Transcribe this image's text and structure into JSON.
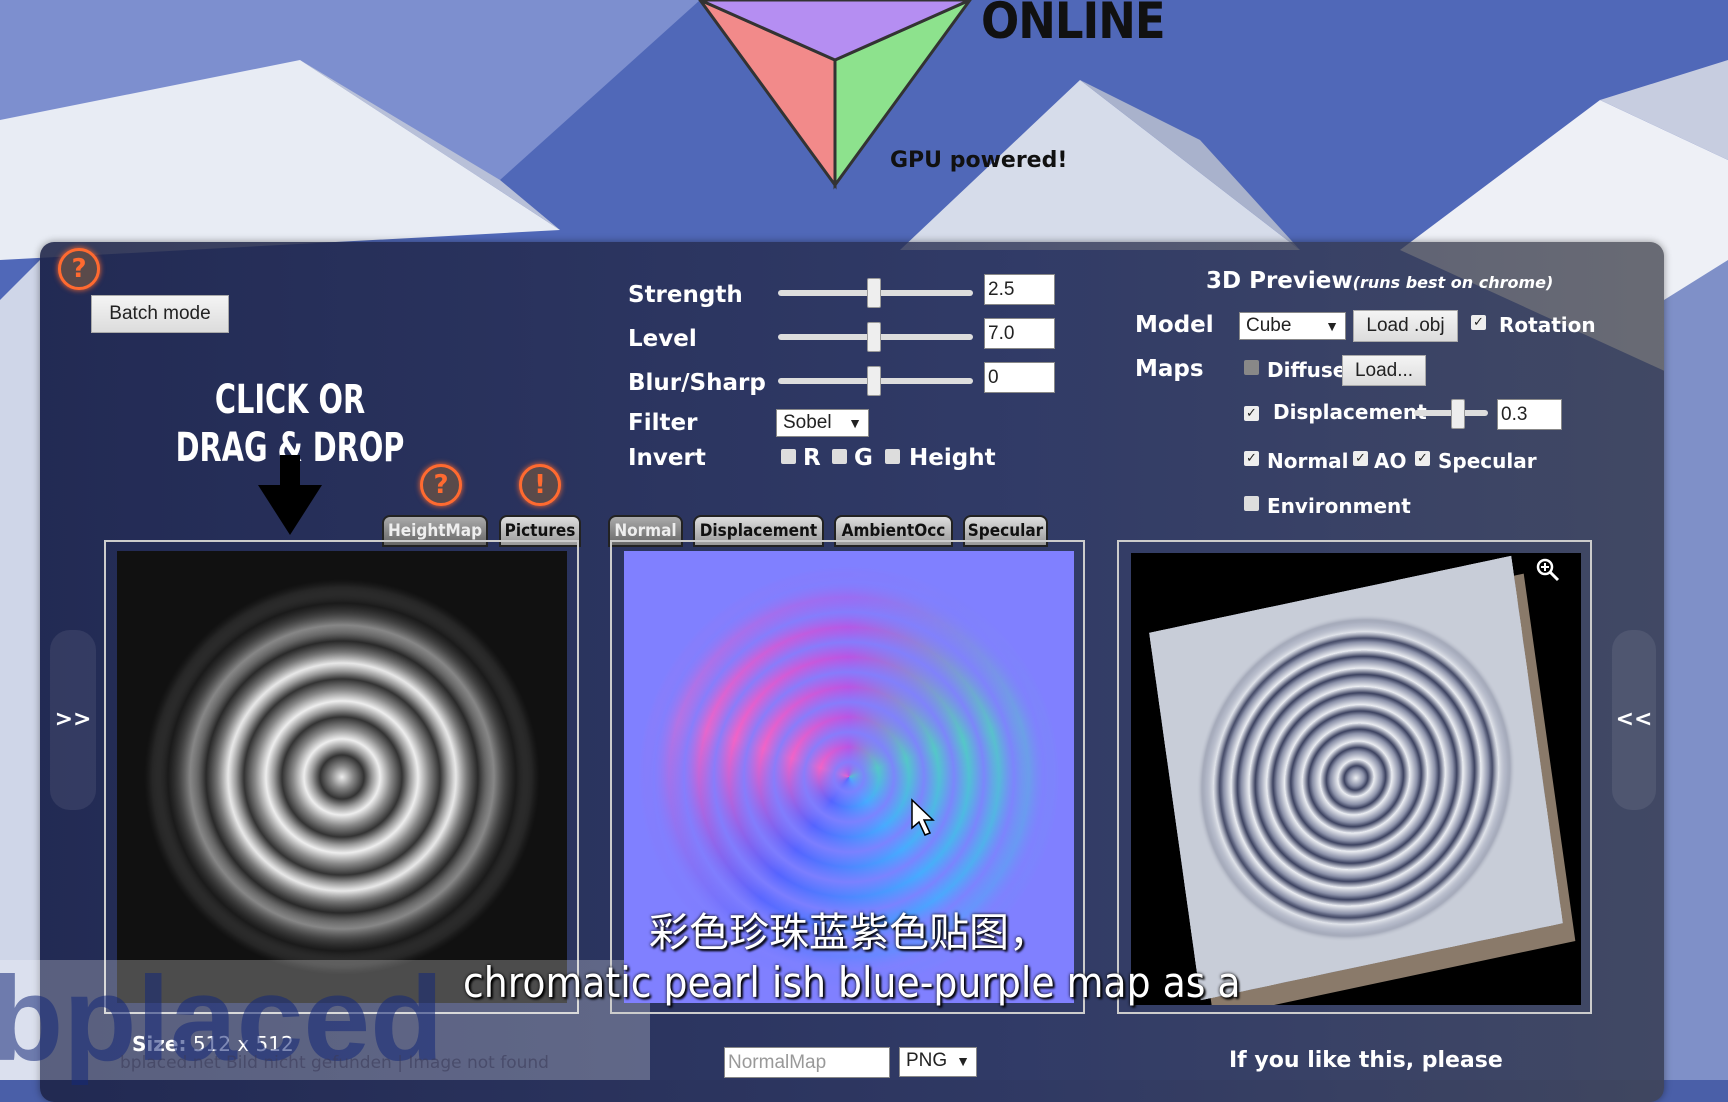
{
  "logo": {
    "word": "ONLINE",
    "tagline": "GPU powered!"
  },
  "left": {
    "batch_label": "Batch mode",
    "drop_text_1": "CLICK OR",
    "drop_text_2": "DRAG & DROP",
    "help": "?",
    "warn": "!",
    "tabs": [
      "HeightMap",
      "Pictures"
    ],
    "size_label": "Size:",
    "size_value": "512 x 512",
    "expand": ">>"
  },
  "settings": {
    "strength": {
      "label": "Strength",
      "value": "2.5"
    },
    "level": {
      "label": "Level",
      "value": "7.0"
    },
    "blur": {
      "label": "Blur/Sharp",
      "value": "0"
    },
    "filter": {
      "label": "Filter",
      "value": "Sobel"
    },
    "invert": {
      "label": "Invert",
      "r": "R",
      "g": "G",
      "height": "Height",
      "checked": [
        false,
        false,
        false
      ]
    }
  },
  "middle": {
    "tabs": [
      "Normal",
      "Displacement",
      "AmbientOcc",
      "Specular"
    ],
    "active_tab": "Normal",
    "filename_placeholder": "NormalMap",
    "format": "PNG"
  },
  "preview": {
    "title": "3D Preview",
    "subtitle": "(runs best on chrome)",
    "model_label": "Model",
    "model_value": "Cube",
    "load_obj": "Load .obj",
    "rotation": "Rotation",
    "rotation_checked": true,
    "maps_label": "Maps",
    "diffuse": "Diffuse",
    "diffuse_checked": false,
    "load_diffuse": "Load...",
    "displacement": "Displacement",
    "displacement_checked": true,
    "displacement_value": "0.3",
    "normal": "Normal",
    "ao": "AO",
    "specular": "Specular",
    "normal_checked": true,
    "ao_checked": true,
    "specular_checked": true,
    "environment": "Environment",
    "environment_checked": false,
    "collapse": "<<",
    "like": "If you like this, please"
  },
  "ad": {
    "logo": "bplaced",
    "line": "bplaced.net Bild nicht gefunden | Image not found"
  },
  "subtitles": {
    "zh": "彩色珍珠蓝紫色贴图，",
    "en": "chromatic pearl ish blue-purple map as a"
  },
  "colors": {
    "accent": "#ff6a30",
    "normal_base": "#8080ff"
  },
  "icons": {
    "zoom": "magnifier-plus-icon",
    "help": "question-circle-icon",
    "warning": "exclamation-circle-icon"
  }
}
